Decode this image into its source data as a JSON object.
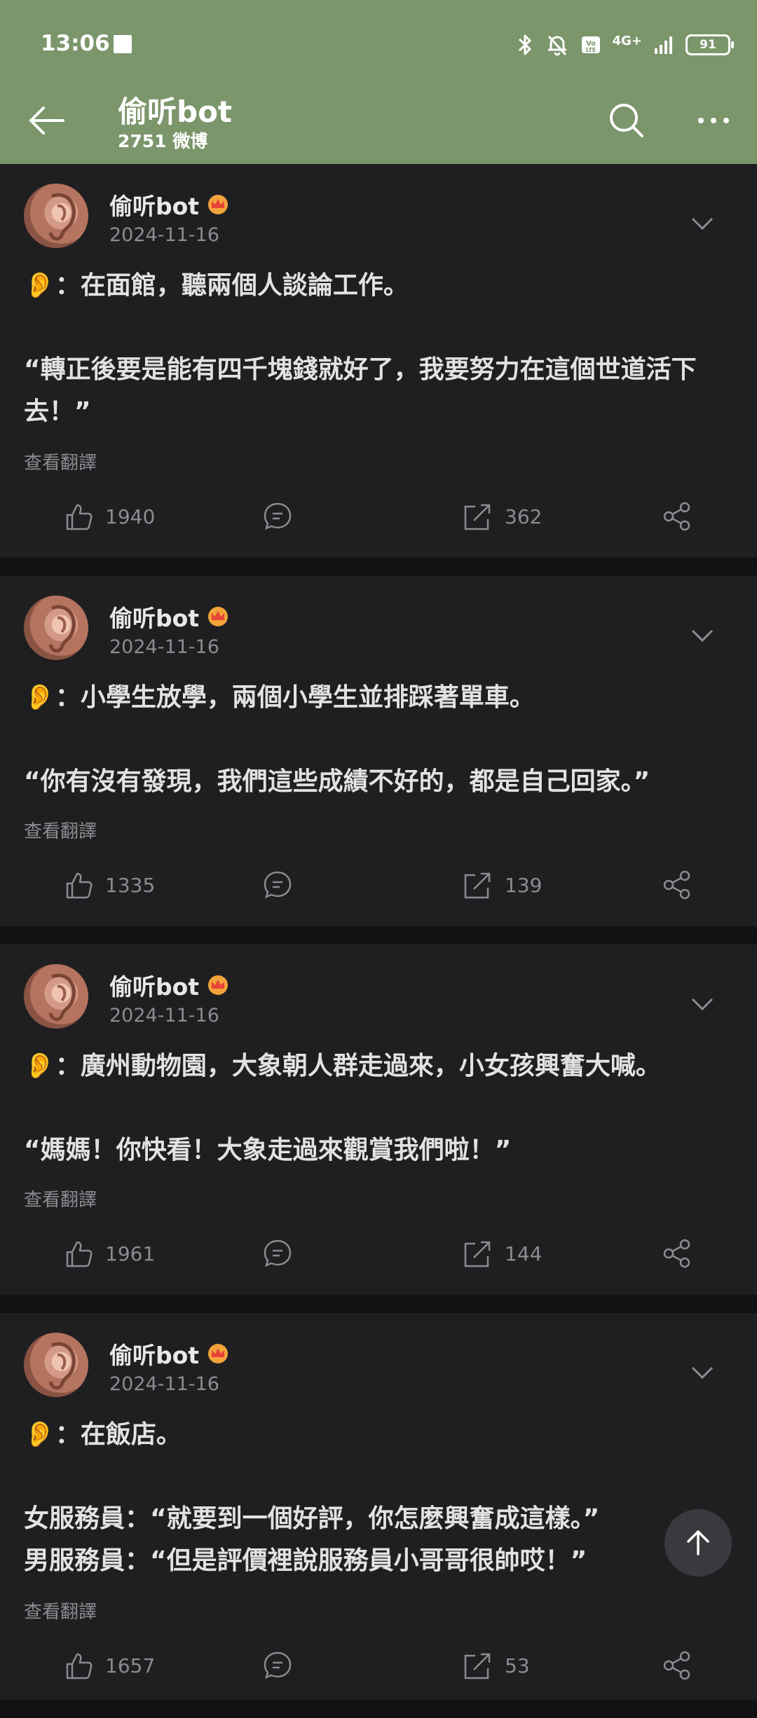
{
  "status_bar": {
    "time": "13:06",
    "battery": "91",
    "network": "4G+"
  },
  "header": {
    "title": "偷听bot",
    "subtitle": "2751 微博",
    "back_icon": "back-arrow-icon",
    "search_icon": "search-icon",
    "more_icon": "more-icon"
  },
  "posts": [
    {
      "author": "偷听bot",
      "date": "2024-11-16",
      "text": "👂：在面館，聽兩個人談論工作。\n\n“轉正後要是能有四千塊錢就好了，我要努力在這個世道活下去！”",
      "translate_label": "查看翻譯",
      "likes": "1940",
      "reposts": "362"
    },
    {
      "author": "偷听bot",
      "date": "2024-11-16",
      "text": "👂：小學生放學，兩個小學生並排踩著單車。\n\n“你有沒有發現，我們這些成績不好的，都是自己回家。”",
      "translate_label": "查看翻譯",
      "likes": "1335",
      "reposts": "139"
    },
    {
      "author": "偷听bot",
      "date": "2024-11-16",
      "text": "👂：廣州動物園，大象朝人群走過來，小女孩興奮大喊。\n\n“媽媽！你快看！大象走過來觀賞我們啦！”",
      "translate_label": "查看翻譯",
      "likes": "1961",
      "reposts": "144"
    },
    {
      "author": "偷听bot",
      "date": "2024-11-16",
      "text": "👂：在飯店。\n\n女服務員：“就要到一個好評，你怎麼興奮成這樣。”\n男服務員：“但是評價裡說服務員小哥哥很帥哎！”",
      "translate_label": "查看翻譯",
      "likes": "1657",
      "reposts": "53"
    }
  ]
}
